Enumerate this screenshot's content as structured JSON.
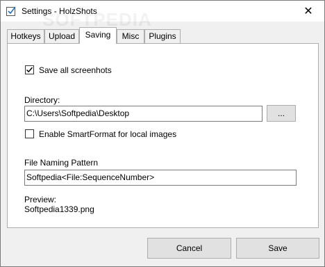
{
  "window": {
    "title": "Settings - HolzShots",
    "close_glyph": "✕"
  },
  "watermark": "SOFTPEDIA",
  "tabs": [
    {
      "label": "Hotkeys",
      "active": false
    },
    {
      "label": "Upload",
      "active": false
    },
    {
      "label": "Saving",
      "active": true
    },
    {
      "label": "Misc",
      "active": false
    },
    {
      "label": "Plugins",
      "active": false
    }
  ],
  "saving": {
    "save_all": {
      "label": "Save all screenhots",
      "checked": true
    },
    "directory": {
      "label": "Directory:",
      "value": "C:\\Users\\Softpedia\\Desktop",
      "browse_label": "..."
    },
    "smartformat": {
      "label": "Enable SmartFormat for local images",
      "checked": false
    },
    "naming": {
      "label": "File Naming Pattern",
      "value": "Softpedia<File:SequenceNumber>"
    },
    "preview": {
      "label": "Preview:",
      "value": "Softpedia1339.png"
    }
  },
  "footer": {
    "cancel_label": "Cancel",
    "save_label": "Save"
  }
}
